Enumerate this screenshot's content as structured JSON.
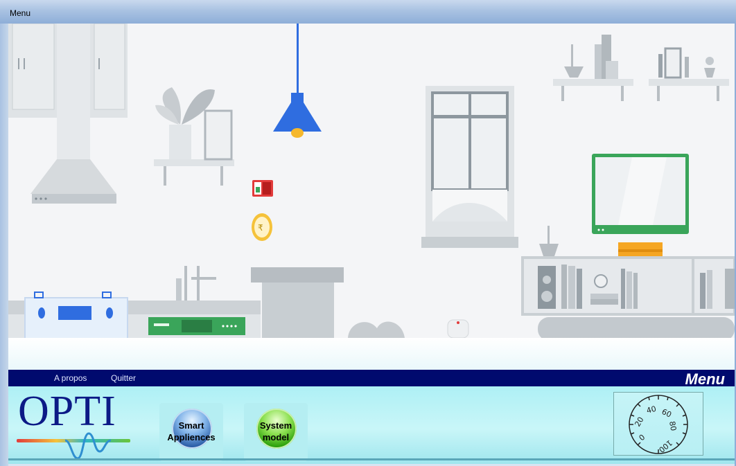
{
  "window": {
    "title": "Menu"
  },
  "menubar": {
    "items": [
      {
        "label": "A propos"
      },
      {
        "label": "Quitter"
      }
    ],
    "title": "Menu"
  },
  "logo": {
    "text": "OPTI"
  },
  "buttons": {
    "smart_appliances": {
      "line1": "Smart",
      "line2": "Appliences"
    },
    "system_model": {
      "line1": "System",
      "line2": "model"
    }
  },
  "dial": {
    "ticks": [
      "0",
      "20",
      "40",
      "60",
      "80",
      "100"
    ]
  },
  "colors": {
    "menubar": "#000a6e",
    "lamp": "#2f6de0",
    "tv_frame": "#3aa55a",
    "alarm_red": "#e23b3b",
    "router_green": "#3aa55a"
  }
}
